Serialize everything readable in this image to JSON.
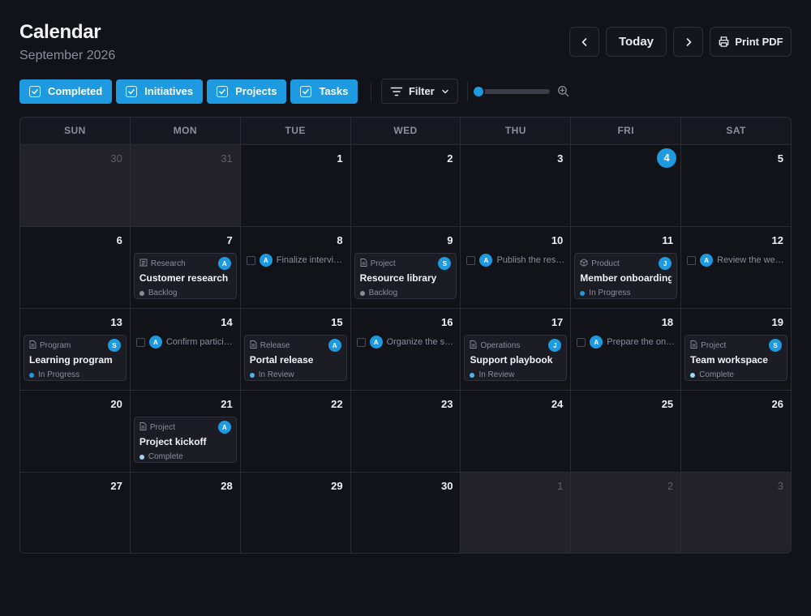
{
  "header": {
    "title": "Calendar",
    "subtitle": "September 2026"
  },
  "nav": {
    "today_label": "Today",
    "print_label": "Print PDF"
  },
  "filters": [
    {
      "label": "Completed",
      "checked": true
    },
    {
      "label": "Initiatives",
      "checked": true
    },
    {
      "label": "Projects",
      "checked": true
    },
    {
      "label": "Tasks",
      "checked": true
    }
  ],
  "filter_button": {
    "label": "Filter"
  },
  "zoom": {
    "level": 0
  },
  "colors": {
    "accent": "#1e9be0",
    "backlog": "#8b8d9b",
    "in_progress": "#1e9be0",
    "in_review": "#4fb3ea",
    "complete": "#9ed6f5"
  },
  "weekdays": [
    "SUN",
    "MON",
    "TUE",
    "WED",
    "THU",
    "FRI",
    "SAT"
  ],
  "weeks": [
    [
      {
        "num": "30",
        "out": true
      },
      {
        "num": "31",
        "out": true
      },
      {
        "num": "1"
      },
      {
        "num": "2"
      },
      {
        "num": "3"
      },
      {
        "num": "4",
        "today": true
      },
      {
        "num": "5"
      }
    ],
    [
      {
        "num": "6"
      },
      {
        "num": "7",
        "item": {
          "kind": "card",
          "type": "Research",
          "icon": "research-icon",
          "title": "Customer research",
          "status": "Backlog",
          "status_key": "backlog",
          "avatar": "A"
        }
      },
      {
        "num": "8",
        "item": {
          "kind": "task",
          "avatar": "A",
          "text": "Finalize interview notes"
        }
      },
      {
        "num": "9",
        "item": {
          "kind": "card",
          "type": "Project",
          "icon": "document-icon",
          "title": "Resource library",
          "status": "Backlog",
          "status_key": "backlog",
          "avatar": "S"
        }
      },
      {
        "num": "10",
        "item": {
          "kind": "task",
          "avatar": "A",
          "text": "Publish the resource list"
        }
      },
      {
        "num": "11",
        "item": {
          "kind": "card",
          "type": "Product",
          "icon": "cube-icon",
          "title": "Member onboarding",
          "status": "In Progress",
          "status_key": "in_progress",
          "avatar": "J"
        }
      },
      {
        "num": "12",
        "item": {
          "kind": "task",
          "avatar": "A",
          "text": "Review the welcome email"
        }
      }
    ],
    [
      {
        "num": "13",
        "item": {
          "kind": "card",
          "type": "Program",
          "icon": "document-icon",
          "title": "Learning program",
          "status": "In Progress",
          "status_key": "in_progress",
          "avatar": "S"
        }
      },
      {
        "num": "14",
        "item": {
          "kind": "task",
          "avatar": "A",
          "text": "Confirm participants"
        }
      },
      {
        "num": "15",
        "item": {
          "kind": "card",
          "type": "Release",
          "icon": "document-icon",
          "title": "Portal release",
          "status": "In Review",
          "status_key": "in_review",
          "avatar": "A"
        }
      },
      {
        "num": "16",
        "item": {
          "kind": "task",
          "avatar": "A",
          "text": "Organize the shared drive"
        }
      },
      {
        "num": "17",
        "item": {
          "kind": "card",
          "type": "Operations",
          "icon": "document-icon",
          "title": "Support playbook",
          "status": "In Review",
          "status_key": "in_review",
          "avatar": "J"
        }
      },
      {
        "num": "18",
        "item": {
          "kind": "task",
          "avatar": "A",
          "text": "Prepare the onboarding deck"
        }
      },
      {
        "num": "19",
        "item": {
          "kind": "card",
          "type": "Project",
          "icon": "document-icon",
          "title": "Team workspace",
          "status": "Complete",
          "status_key": "complete",
          "avatar": "S"
        }
      }
    ],
    [
      {
        "num": "20"
      },
      {
        "num": "21",
        "item": {
          "kind": "card",
          "type": "Project",
          "icon": "document-icon",
          "title": "Project kickoff",
          "status": "Complete",
          "status_key": "complete",
          "avatar": "A"
        }
      },
      {
        "num": "22"
      },
      {
        "num": "23"
      },
      {
        "num": "24"
      },
      {
        "num": "25"
      },
      {
        "num": "26"
      }
    ],
    [
      {
        "num": "27"
      },
      {
        "num": "28"
      },
      {
        "num": "29"
      },
      {
        "num": "30"
      },
      {
        "num": "1",
        "out": true
      },
      {
        "num": "2",
        "out": true
      },
      {
        "num": "3",
        "out": true
      }
    ]
  ]
}
